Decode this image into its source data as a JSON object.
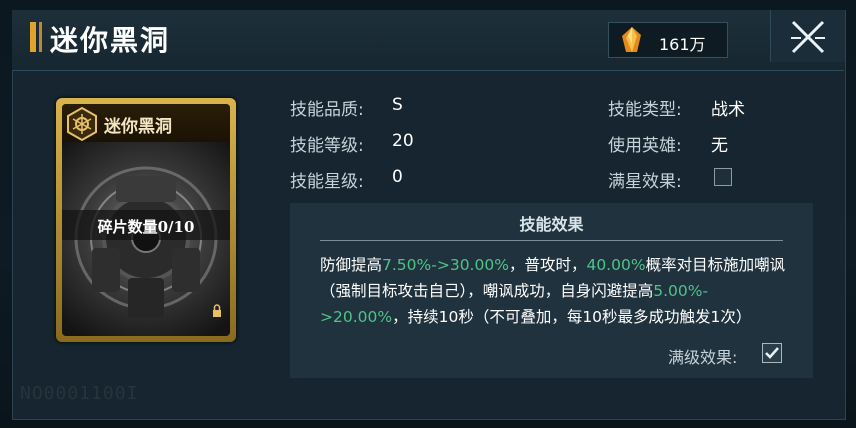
{
  "header": {
    "title": "迷你黑洞",
    "currency_amount": "161万",
    "currency_icon": "crystal-icon",
    "close_icon": "close-icon"
  },
  "card": {
    "name": "迷你黑洞",
    "fragments_label": "碎片数量0/10"
  },
  "info": {
    "quality_label": "技能品质:",
    "quality_value": "S",
    "level_label": "技能等级:",
    "level_value": "20",
    "star_label": "技能星级:",
    "star_value": "0",
    "type_label": "技能类型:",
    "type_value": "战术",
    "hero_label": "使用英雄:",
    "hero_value": "无",
    "full_star_label": "满星效果:"
  },
  "effect": {
    "title": "技能效果",
    "seg1": "防御提高",
    "seg2": "7.50%->30.00%",
    "seg3": "，普攻时，",
    "seg4": "40.00%",
    "seg5": "概率对目标施加嘲讽（强制目标攻击自己），嘲讽成功，自身闪避提高",
    "seg6": "5.00%->20.00%",
    "seg7": "，持续10秒（不可叠加，每10秒最多成功触发1次）",
    "max_label": "满级效果:"
  },
  "watermark": "NO0001100I",
  "colors": {
    "accent_gold": "#e2a32a",
    "highlight_green": "#4fc38a"
  }
}
